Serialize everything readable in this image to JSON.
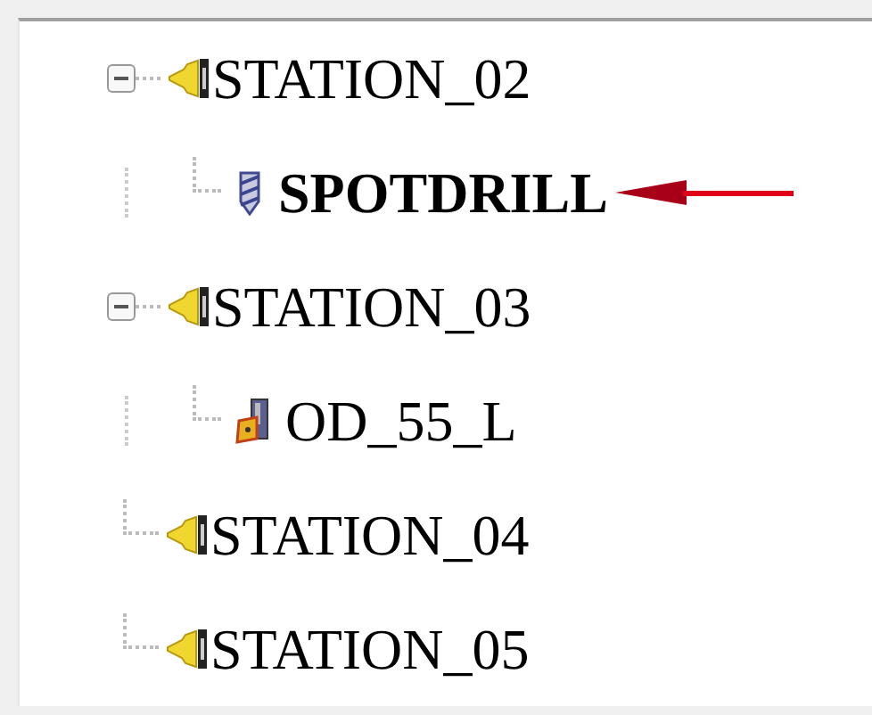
{
  "tree": [
    {
      "label": "STATION_02",
      "kind": "station",
      "expanded": true,
      "selected": false,
      "children": [
        {
          "label": "SPOTDRILL",
          "kind": "drill",
          "selected": true
        }
      ]
    },
    {
      "label": "STATION_03",
      "kind": "station",
      "expanded": true,
      "selected": false,
      "children": [
        {
          "label": "OD_55_L",
          "kind": "insert",
          "selected": false
        }
      ]
    },
    {
      "label": "STATION_04",
      "kind": "station",
      "selected": false
    },
    {
      "label": "STATION_05",
      "kind": "station",
      "selected": false
    }
  ]
}
